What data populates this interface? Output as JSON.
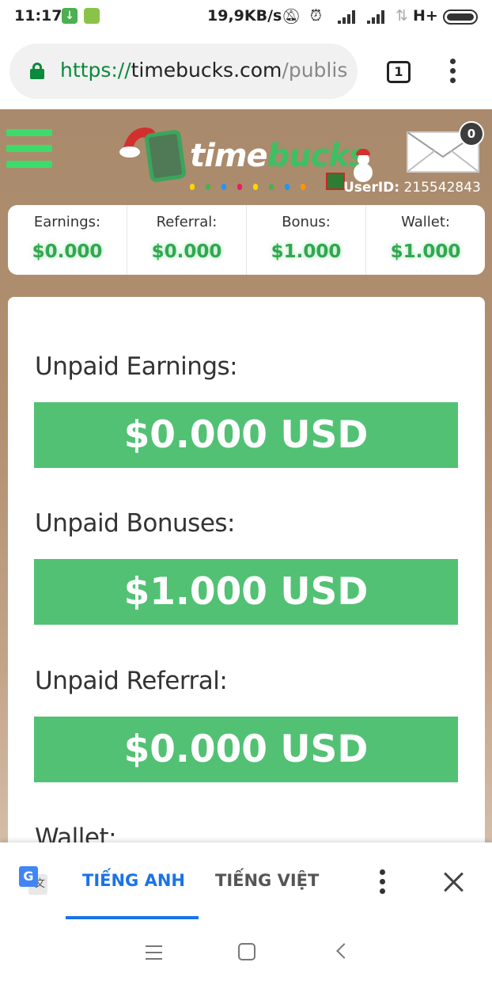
{
  "status_bar": {
    "time": "11:17",
    "net_speed": "19,9KB/s",
    "network_type": "H+"
  },
  "browser": {
    "url_scheme": "https://",
    "url_host": "timebucks.com",
    "url_path": "/publis",
    "tab_count": "1"
  },
  "site": {
    "logo_word_1": "time",
    "logo_word_2": "bucks",
    "mail_count": "0",
    "userid_label": "UserID:",
    "userid_value": "215542843",
    "stats": [
      {
        "label": "Earnings:",
        "value": "$0.000"
      },
      {
        "label": "Referral:",
        "value": "$0.000"
      },
      {
        "label": "Bonus:",
        "value": "$1.000"
      },
      {
        "label": "Wallet:",
        "value": "$1.000"
      }
    ],
    "card": {
      "sections": [
        {
          "label": "Unpaid Earnings:",
          "amount": "$0.000 USD"
        },
        {
          "label": "Unpaid Bonuses:",
          "amount": "$1.000 USD"
        },
        {
          "label": "Unpaid Referral:",
          "amount": "$0.000 USD"
        },
        {
          "label": "Wallet:"
        }
      ]
    },
    "colors": {
      "accent_green": "#52c174",
      "background_brown": "#a98a6c"
    }
  },
  "translate_bar": {
    "icon": "google-translate-icon",
    "source_language": "TIẾNG ANH",
    "target_language": "TIẾNG VIỆT"
  },
  "icons": [
    "download-icon",
    "mute-icon",
    "alarm-icon",
    "signal-icon",
    "battery-icon",
    "lock-icon",
    "tabs-icon",
    "more-vert-icon",
    "hamburger-menu-icon",
    "mail-icon",
    "close-icon",
    "recents-icon",
    "home-icon",
    "back-icon"
  ]
}
